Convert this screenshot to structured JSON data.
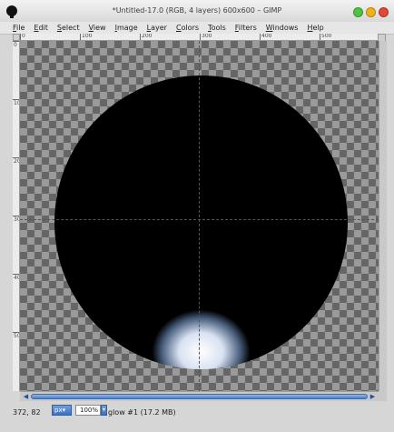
{
  "window": {
    "title": "*Untitled-17.0 (RGB, 4 layers) 600x600 – GIMP"
  },
  "menu": [
    "File",
    "Edit",
    "Select",
    "View",
    "Image",
    "Layer",
    "Colors",
    "Tools",
    "Filters",
    "Windows",
    "Help"
  ],
  "rulers": {
    "horizontal_labels": [
      "0",
      "100",
      "200",
      "300",
      "400",
      "500"
    ],
    "vertical_labels": [
      "0",
      "100",
      "200",
      "300",
      "400",
      "500"
    ]
  },
  "status": {
    "coords": "372, 82",
    "unit": "px",
    "zoom": "100%",
    "layer_info": "glow #1 (17.2 MB)"
  },
  "icons": {
    "app": "gimp-icon",
    "nav": "navigate-icon",
    "unit_dropdown": "chevron-down-icon"
  },
  "colors": {
    "guide": "#2d55c0",
    "scroll_accent": "#4f82c8",
    "orb_rim": "#5d89c8"
  }
}
